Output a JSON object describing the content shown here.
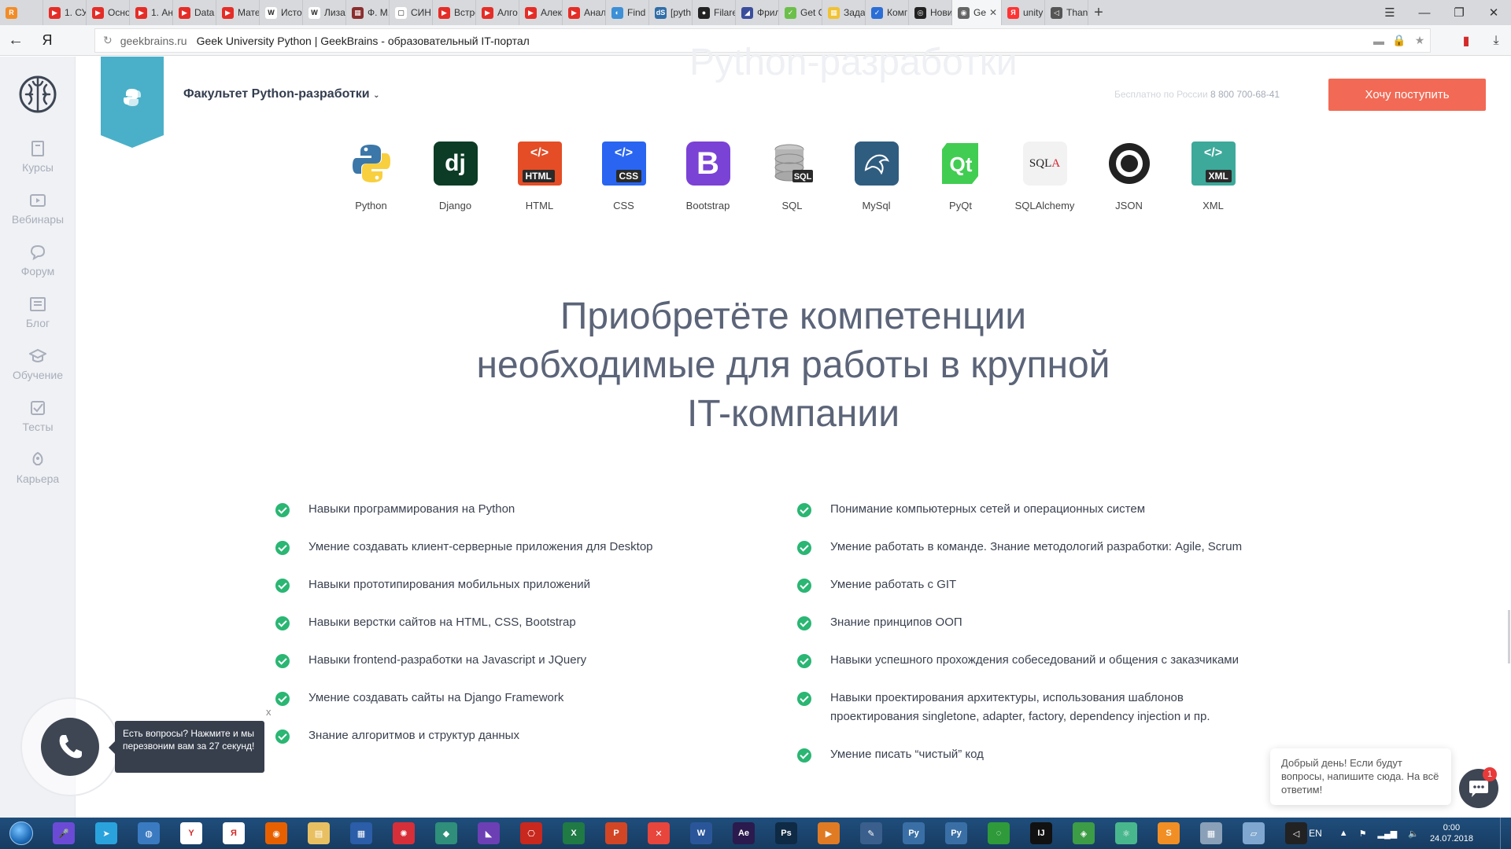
{
  "browser": {
    "tabs": [
      {
        "label": "",
        "color": "#f28c28",
        "glyph": "R"
      },
      {
        "label": "1. СУ",
        "color": "#e52d27",
        "glyph": "▶"
      },
      {
        "label": "Осно",
        "color": "#e52d27",
        "glyph": "▶"
      },
      {
        "label": "1. Ан",
        "color": "#e52d27",
        "glyph": "▶"
      },
      {
        "label": "Data",
        "color": "#e52d27",
        "glyph": "▶"
      },
      {
        "label": "Мате",
        "color": "#e52d27",
        "glyph": "▶"
      },
      {
        "label": "Исто",
        "color": "#ffffff",
        "glyph": "W"
      },
      {
        "label": "Лиза",
        "color": "#ffffff",
        "glyph": "W"
      },
      {
        "label": "Ф. М.",
        "color": "#8a2e2e",
        "glyph": "▦"
      },
      {
        "label": "СИН",
        "color": "#ffffff",
        "glyph": "▢"
      },
      {
        "label": "Встре",
        "color": "#e52d27",
        "glyph": "▶"
      },
      {
        "label": "Алго",
        "color": "#e52d27",
        "glyph": "▶"
      },
      {
        "label": "Алек",
        "color": "#e52d27",
        "glyph": "▶"
      },
      {
        "label": "Анал",
        "color": "#e52d27",
        "glyph": "▶"
      },
      {
        "label": "Find",
        "color": "#3d8fd6",
        "glyph": "◐"
      },
      {
        "label": "[pyth",
        "color": "#2f6ea8",
        "glyph": "dS"
      },
      {
        "label": "Filare",
        "color": "#222222",
        "glyph": "●"
      },
      {
        "label": "Фрил",
        "color": "#3a4e9c",
        "glyph": "◢"
      },
      {
        "label": "Get C",
        "color": "#6cbf4a",
        "glyph": "✓"
      },
      {
        "label": "Зада",
        "color": "#f1c232",
        "glyph": "▦"
      },
      {
        "label": "Комг",
        "color": "#2b6fd6",
        "glyph": "✓"
      },
      {
        "label": "Нови",
        "color": "#222222",
        "glyph": "◎"
      },
      {
        "label": "Ge",
        "color": "#666666",
        "glyph": "◉"
      },
      {
        "label": "unity",
        "color": "#ff3333",
        "glyph": "Я"
      },
      {
        "label": "Than",
        "color": "#555555",
        "glyph": "◁"
      }
    ],
    "active_tab_index": 22,
    "close_glyph": "✕",
    "new_tab_glyph": "+",
    "window_controls": [
      "☰",
      "—",
      "❐",
      "✕"
    ],
    "url_domain": "geekbrains.ru",
    "page_title": "Geek University Python | GeekBrains - образовательный IT-портал",
    "back_glyph": "←",
    "yandex_glyph": "Я"
  },
  "sidebar": {
    "items": [
      {
        "label": "Курсы",
        "icon": "book-icon"
      },
      {
        "label": "Вебинары",
        "icon": "video-icon"
      },
      {
        "label": "Форум",
        "icon": "chat-icon"
      },
      {
        "label": "Блог",
        "icon": "newspaper-icon"
      },
      {
        "label": "Обучение",
        "icon": "graduation-cap-icon"
      },
      {
        "label": "Тесты",
        "icon": "checkbox-icon"
      },
      {
        "label": "Карьера",
        "icon": "rocket-icon"
      }
    ]
  },
  "header": {
    "ghost_title": "Python-разработки",
    "faculty_name": "Факультет Python-разработки",
    "phone_label": "Бесплатно по России",
    "phone_number": "8 800 700-68-41",
    "cta_label": "Хочу поступить",
    "accent_color": "#4ab0c9",
    "cta_color": "#f26a55"
  },
  "technologies": [
    {
      "label": "Python",
      "icon": "python-logo-icon"
    },
    {
      "label": "Django",
      "icon": "django-logo-icon"
    },
    {
      "label": "HTML",
      "icon": "html-file-icon"
    },
    {
      "label": "CSS",
      "icon": "css-file-icon"
    },
    {
      "label": "Bootstrap",
      "icon": "bootstrap-logo-icon"
    },
    {
      "label": "SQL",
      "icon": "database-icon"
    },
    {
      "label": "MySql",
      "icon": "mysql-dolphin-icon"
    },
    {
      "label": "PyQt",
      "icon": "qt-logo-icon"
    },
    {
      "label": "SQLAlchemy",
      "icon": "sqlalchemy-logo-icon"
    },
    {
      "label": "JSON",
      "icon": "json-logo-icon"
    },
    {
      "label": "XML",
      "icon": "xml-file-icon"
    }
  ],
  "headline": {
    "line1": "Приобретёте компетенции",
    "line2": "необходимые для работы в крупной",
    "line3": "IT-компании"
  },
  "skills_left": [
    "Навыки программирования на Python",
    "Умение создавать клиент-серверные приложения для Desktop",
    "Навыки прототипирования мобильных приложений",
    "Навыки верстки сайтов на HTML, CSS, Bootstrap",
    "Навыки frontend-разработки на Javascript и JQuery",
    "Умение создавать сайты на Django Framework",
    "Знание алгоритмов и структур данных"
  ],
  "skills_right": [
    "Понимание компьютерных сетей и операционных систем",
    "Умение работать в команде. Знание методологий разработки: Agile, Scrum",
    "Умение работать с GIT",
    "Знание принципов ООП",
    "Навыки успешного прохождения собеседований и общения с заказчиками",
    "Навыки проектирования архитектуры, использования шаблонов",
    "Умение писать “чистый” код"
  ],
  "skills_right_continuation": "проектирования singletone, adapter, factory, dependency injection и пр.",
  "call_widget": {
    "tooltip": "Есть вопросы? Нажмите и мы перезвоним вам за 27 секунд!",
    "close_label": "x"
  },
  "chat_widget": {
    "message": "Добрый день! Если будут вопросы, напишите сюда. На всё ответим!",
    "badge_count": "1"
  },
  "taskbar": {
    "icons": [
      {
        "name": "microphone-icon",
        "color": "#6b4bd6",
        "glyph": "🎤"
      },
      {
        "name": "telegram-icon",
        "color": "#2aa3dd",
        "glyph": "➤"
      },
      {
        "name": "globe-icon",
        "color": "#3a7ac0",
        "glyph": "◍"
      },
      {
        "name": "yandex-icon",
        "color": "#ffffff",
        "glyph": "Y"
      },
      {
        "name": "yandex-browser-icon",
        "color": "#ffffff",
        "glyph": "Я"
      },
      {
        "name": "firefox-icon",
        "color": "#e66000",
        "glyph": "◉"
      },
      {
        "name": "folder-icon",
        "color": "#e8c062",
        "glyph": "▤"
      },
      {
        "name": "calculator-grid-icon",
        "color": "#2b5da8",
        "glyph": "▦"
      },
      {
        "name": "nodes-icon",
        "color": "#d62f3a",
        "glyph": "✺"
      },
      {
        "name": "cube-icon",
        "color": "#2f8f7a",
        "glyph": "◆"
      },
      {
        "name": "visual-studio-icon",
        "color": "#6c3fb5",
        "glyph": "◣"
      },
      {
        "name": "pdf-icon",
        "color": "#c8281e",
        "glyph": "⎔"
      },
      {
        "name": "excel-icon",
        "color": "#1f7a44",
        "glyph": "X"
      },
      {
        "name": "powerpoint-icon",
        "color": "#d24625",
        "glyph": "P"
      },
      {
        "name": "xmind-icon",
        "color": "#e8453c",
        "glyph": "✕"
      },
      {
        "name": "word-icon",
        "color": "#2a5699",
        "glyph": "W"
      },
      {
        "name": "after-effects-icon",
        "color": "#2b1a4d",
        "glyph": "Ae"
      },
      {
        "name": "photoshop-icon",
        "color": "#0f2a45",
        "glyph": "Ps"
      },
      {
        "name": "media-player-icon",
        "color": "#e07b24",
        "glyph": "▶"
      },
      {
        "name": "pen-icon",
        "color": "#3a5f8c",
        "glyph": "✎"
      },
      {
        "name": "python-icon",
        "color": "#3a6fa6",
        "glyph": "Py"
      },
      {
        "name": "python-idle-icon",
        "color": "#3a6fa6",
        "glyph": "Py"
      },
      {
        "name": "loader-ring-icon",
        "color": "#2e9a3a",
        "glyph": "◌"
      },
      {
        "name": "intellij-icon",
        "color": "#111111",
        "glyph": "IJ"
      },
      {
        "name": "android-studio-icon",
        "color": "#3d9c46",
        "glyph": "◈"
      },
      {
        "name": "atom-icon",
        "color": "#49b78d",
        "glyph": "⚛"
      },
      {
        "name": "sublime-icon",
        "color": "#f28f24",
        "glyph": "S"
      },
      {
        "name": "calculator-icon",
        "color": "#8aa0b8",
        "glyph": "▦"
      },
      {
        "name": "notepad-icon",
        "color": "#7fa7cf",
        "glyph": "▱"
      },
      {
        "name": "unity-icon",
        "color": "#222222",
        "glyph": "◁"
      }
    ],
    "lang": "EN",
    "time": "0:00",
    "date": "24.07.2018"
  }
}
